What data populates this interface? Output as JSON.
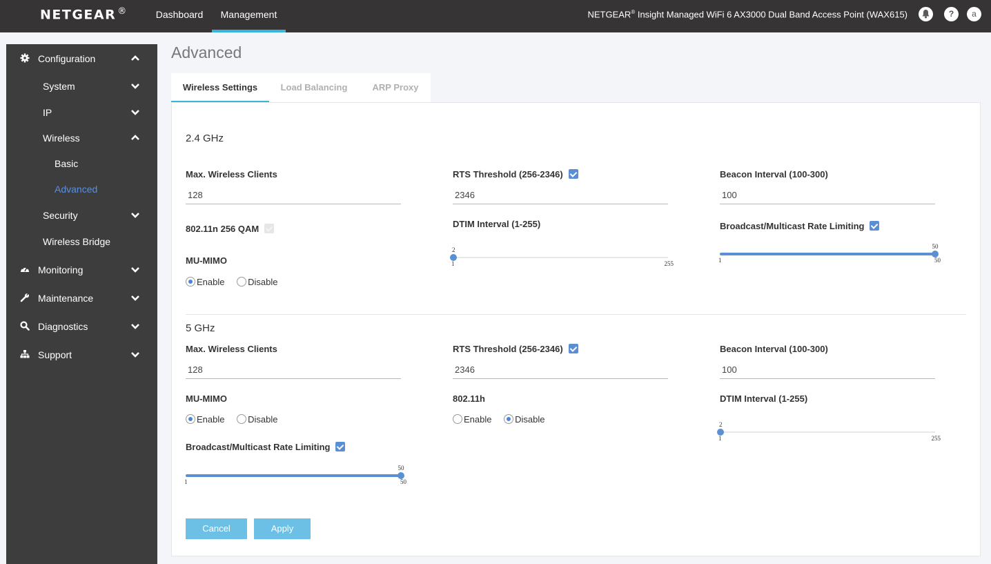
{
  "header": {
    "brand": "NETGEAR",
    "brand_mark": "®",
    "nav": [
      {
        "label": "Dashboard",
        "active": false
      },
      {
        "label": "Management",
        "active": true
      }
    ],
    "device_prefix": "NETGEAR",
    "device_mark": "®",
    "device_title": " Insight Managed WiFi 6 AX3000 Dual Band Access Point (WAX615)",
    "icons": {
      "bell": "bell-icon",
      "help": "?",
      "account": "a"
    }
  },
  "sidebar": {
    "items": [
      {
        "label": "Configuration",
        "icon": "gear-icon",
        "chevron": "up"
      },
      {
        "label": "System",
        "chevron": "down"
      },
      {
        "label": "IP",
        "chevron": "down"
      },
      {
        "label": "Wireless",
        "chevron": "up"
      },
      {
        "label": "Basic"
      },
      {
        "label": "Advanced",
        "active": true
      },
      {
        "label": "Security",
        "chevron": "down"
      },
      {
        "label": "Wireless Bridge"
      },
      {
        "label": "Monitoring",
        "icon": "dashboard-gauge-icon",
        "chevron": "down"
      },
      {
        "label": "Maintenance",
        "icon": "wrench-icon",
        "chevron": "down"
      },
      {
        "label": "Diagnostics",
        "icon": "search-icon",
        "chevron": "down"
      },
      {
        "label": "Support",
        "icon": "sitemap-icon",
        "chevron": "down"
      }
    ]
  },
  "page": {
    "title": "Advanced",
    "tabs": [
      {
        "label": "Wireless Settings",
        "active": true
      },
      {
        "label": "Load Balancing",
        "active": false
      },
      {
        "label": "ARP Proxy",
        "active": false
      }
    ]
  },
  "band24": {
    "title": "2.4 GHz",
    "max_clients": {
      "label": "Max. Wireless Clients",
      "value": "128"
    },
    "rts": {
      "label": "RTS Threshold (256-2346)",
      "checked": true,
      "value": "2346"
    },
    "beacon": {
      "label": "Beacon Interval (100-300)",
      "value": "100"
    },
    "qam": {
      "label": "802.11n 256 QAM",
      "checked": true,
      "disabled": true
    },
    "dtim": {
      "label": "DTIM Interval (1-255)",
      "value": "2",
      "min": "1",
      "max": "255"
    },
    "rate_limit": {
      "label": "Broadcast/Multicast Rate Limiting",
      "checked": true,
      "value": "50",
      "min": "1",
      "max": "50"
    },
    "mumimo": {
      "label": "MU-MIMO",
      "options": [
        "Enable",
        "Disable"
      ],
      "selected": "Enable"
    }
  },
  "band5": {
    "title": "5 GHz",
    "max_clients": {
      "label": "Max. Wireless Clients",
      "value": "128"
    },
    "rts": {
      "label": "RTS Threshold (256-2346)",
      "checked": true,
      "value": "2346"
    },
    "beacon": {
      "label": "Beacon Interval (100-300)",
      "value": "100"
    },
    "mumimo": {
      "label": "MU-MIMO",
      "options": [
        "Enable",
        "Disable"
      ],
      "selected": "Enable"
    },
    "dot11h": {
      "label": "802.11h",
      "options": [
        "Enable",
        "Disable"
      ],
      "selected": "Disable"
    },
    "dtim": {
      "label": "DTIM Interval (1-255)",
      "value": "2",
      "min": "1",
      "max": "255"
    },
    "rate_limit": {
      "label": "Broadcast/Multicast Rate Limiting",
      "checked": true,
      "value": "50",
      "min": "1",
      "max": "50"
    }
  },
  "actions": {
    "cancel": "Cancel",
    "apply": "Apply"
  },
  "colors": {
    "accent": "#39b4dd",
    "primary": "#5b8fd4",
    "button": "#6cc0e5",
    "topbar": "#363434",
    "sidebar": "#3d3d3d"
  }
}
